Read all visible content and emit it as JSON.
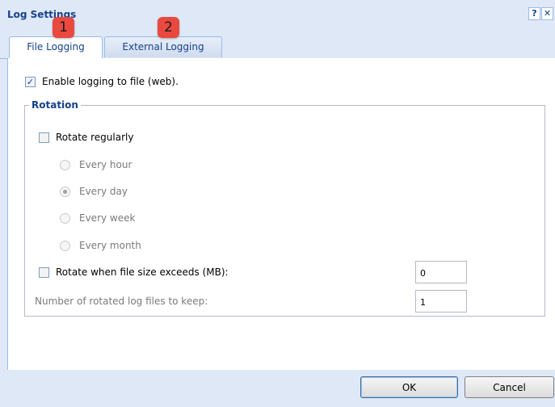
{
  "window": {
    "title": "Log Settings",
    "help_glyph": "?",
    "close_glyph": "✕"
  },
  "tabs": [
    {
      "label": "File Logging",
      "active": true
    },
    {
      "label": "External Logging",
      "active": false
    }
  ],
  "annotations": {
    "badge1": "1",
    "badge2": "2"
  },
  "main": {
    "enable_logging": {
      "label": "Enable logging to file (web).",
      "checked": true,
      "glyph": "✓"
    },
    "rotation": {
      "legend": "Rotation",
      "rotate_regularly": {
        "label": "Rotate regularly",
        "checked": false
      },
      "options": [
        {
          "label": "Every hour",
          "selected": false
        },
        {
          "label": "Every day",
          "selected": true
        },
        {
          "label": "Every week",
          "selected": false
        },
        {
          "label": "Every month",
          "selected": false
        }
      ],
      "rotate_size": {
        "label": "Rotate when file size exceeds (MB):",
        "checked": false,
        "value": "0"
      },
      "keep_files": {
        "label": "Number of rotated log files to keep:",
        "value": "1"
      }
    }
  },
  "buttons": {
    "ok": "OK",
    "cancel": "Cancel"
  },
  "colors": {
    "accent": "#15428b",
    "badge": "#e9493f",
    "window_bg": "#dfe8f6"
  }
}
